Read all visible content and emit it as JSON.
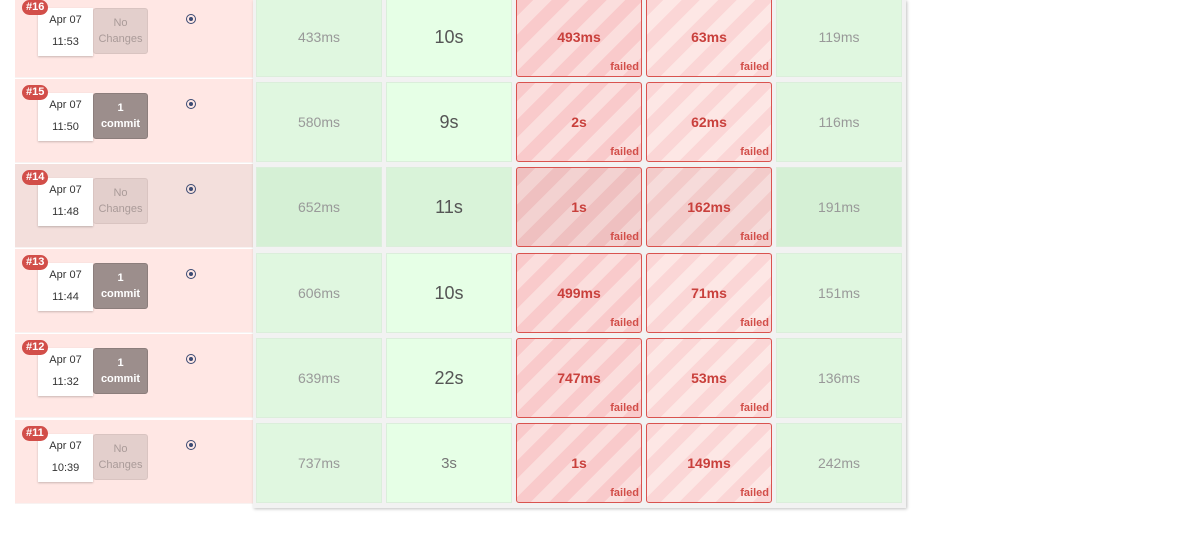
{
  "failed_label": "failed",
  "colors": {
    "badge": "#d24e49",
    "success_cell": "#e0f7e0",
    "failed_cell": "#f9cacb",
    "row_background": "#ffe7e4"
  },
  "builds": [
    {
      "number": "#16",
      "date": "Apr 07",
      "time": "11:53",
      "changes": [
        "No",
        "Changes"
      ],
      "has_commit": false,
      "highlighted": false,
      "stages": [
        {
          "value": "433ms",
          "status": "success"
        },
        {
          "value": "10s",
          "status": "success"
        },
        {
          "value": "493ms",
          "status": "failed"
        },
        {
          "value": "63ms",
          "status": "failed"
        },
        {
          "value": "119ms",
          "status": "success"
        }
      ]
    },
    {
      "number": "#15",
      "date": "Apr 07",
      "time": "11:50",
      "changes": [
        "1",
        "commit"
      ],
      "has_commit": true,
      "highlighted": false,
      "stages": [
        {
          "value": "580ms",
          "status": "success"
        },
        {
          "value": "9s",
          "status": "success"
        },
        {
          "value": "2s",
          "status": "failed"
        },
        {
          "value": "62ms",
          "status": "failed"
        },
        {
          "value": "116ms",
          "status": "success"
        }
      ]
    },
    {
      "number": "#14",
      "date": "Apr 07",
      "time": "11:48",
      "changes": [
        "No",
        "Changes"
      ],
      "has_commit": false,
      "highlighted": true,
      "stages": [
        {
          "value": "652ms",
          "status": "success"
        },
        {
          "value": "11s",
          "status": "success"
        },
        {
          "value": "1s",
          "status": "failed"
        },
        {
          "value": "162ms",
          "status": "failed"
        },
        {
          "value": "191ms",
          "status": "success"
        }
      ]
    },
    {
      "number": "#13",
      "date": "Apr 07",
      "time": "11:44",
      "changes": [
        "1",
        "commit"
      ],
      "has_commit": true,
      "highlighted": false,
      "stages": [
        {
          "value": "606ms",
          "status": "success"
        },
        {
          "value": "10s",
          "status": "success"
        },
        {
          "value": "499ms",
          "status": "failed"
        },
        {
          "value": "71ms",
          "status": "failed"
        },
        {
          "value": "151ms",
          "status": "success"
        }
      ]
    },
    {
      "number": "#12",
      "date": "Apr 07",
      "time": "11:32",
      "changes": [
        "1",
        "commit"
      ],
      "has_commit": true,
      "highlighted": false,
      "stages": [
        {
          "value": "639ms",
          "status": "success"
        },
        {
          "value": "22s",
          "status": "success"
        },
        {
          "value": "747ms",
          "status": "failed"
        },
        {
          "value": "53ms",
          "status": "failed"
        },
        {
          "value": "136ms",
          "status": "success"
        }
      ]
    },
    {
      "number": "#11",
      "date": "Apr 07",
      "time": "10:39",
      "changes": [
        "No",
        "Changes"
      ],
      "has_commit": false,
      "highlighted": false,
      "stages": [
        {
          "value": "737ms",
          "status": "success"
        },
        {
          "value": "3s",
          "status": "success"
        },
        {
          "value": "1s",
          "status": "failed"
        },
        {
          "value": "149ms",
          "status": "failed"
        },
        {
          "value": "242ms",
          "status": "success"
        }
      ]
    }
  ]
}
